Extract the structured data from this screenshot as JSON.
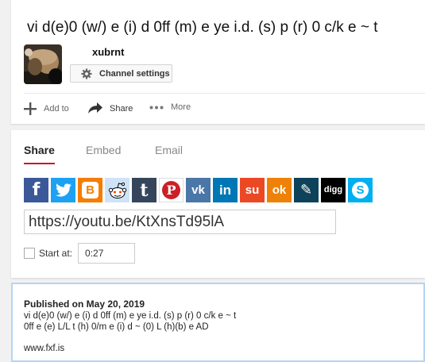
{
  "video": {
    "title": "vi d(e)0 (w/) e (i) d 0ff (m) e ye i.d. (s) p (r) 0 c/k e ~ t"
  },
  "channel": {
    "name": "xubrnt",
    "settings_label": "Channel settings"
  },
  "actions": {
    "add_label": "Add to",
    "share_label": "Share",
    "more_label": "More"
  },
  "share_panel": {
    "tabs": [
      "Share",
      "Embed",
      "Email"
    ],
    "url": "https://youtu.be/KtXnsTd95lA",
    "start_at_label": "Start at:",
    "start_at_value": "0:27",
    "social": [
      {
        "name": "facebook",
        "color": "#3b5998",
        "glyph": "f"
      },
      {
        "name": "twitter",
        "color": "#1da1f2",
        "glyph": ""
      },
      {
        "name": "blogger",
        "color": "#f57d00",
        "glyph": "B"
      },
      {
        "name": "reddit",
        "color": "#cee3f8",
        "glyph": ""
      },
      {
        "name": "tumblr",
        "color": "#35465c",
        "glyph": "t"
      },
      {
        "name": "pinterest",
        "color": "#cb2027",
        "glyph": "P"
      },
      {
        "name": "vk",
        "color": "#4a76a8",
        "glyph": "vk"
      },
      {
        "name": "linkedin",
        "color": "#0077b5",
        "glyph": "in"
      },
      {
        "name": "stumbleupon",
        "color": "#eb4924",
        "glyph": "su"
      },
      {
        "name": "odnoklassniki",
        "color": "#ee8208",
        "glyph": "ok"
      },
      {
        "name": "livejournal",
        "color": "#0d425a",
        "glyph": "✎"
      },
      {
        "name": "digg",
        "color": "#000000",
        "glyph": "digg"
      },
      {
        "name": "skype",
        "color": "#00aff0",
        "glyph": "S"
      }
    ]
  },
  "description": {
    "published": "Published on May 20, 2019",
    "line1": "vi d(e)0 (w/) e (i) d 0ff (m) e ye i.d. (s) p (r) 0 c/k e ~ t",
    "line2": "0ff e (e) L/L t (h) 0/m e (i) d ~ (0) L (h)(b) e AD",
    "link": "www.fxf.is"
  }
}
